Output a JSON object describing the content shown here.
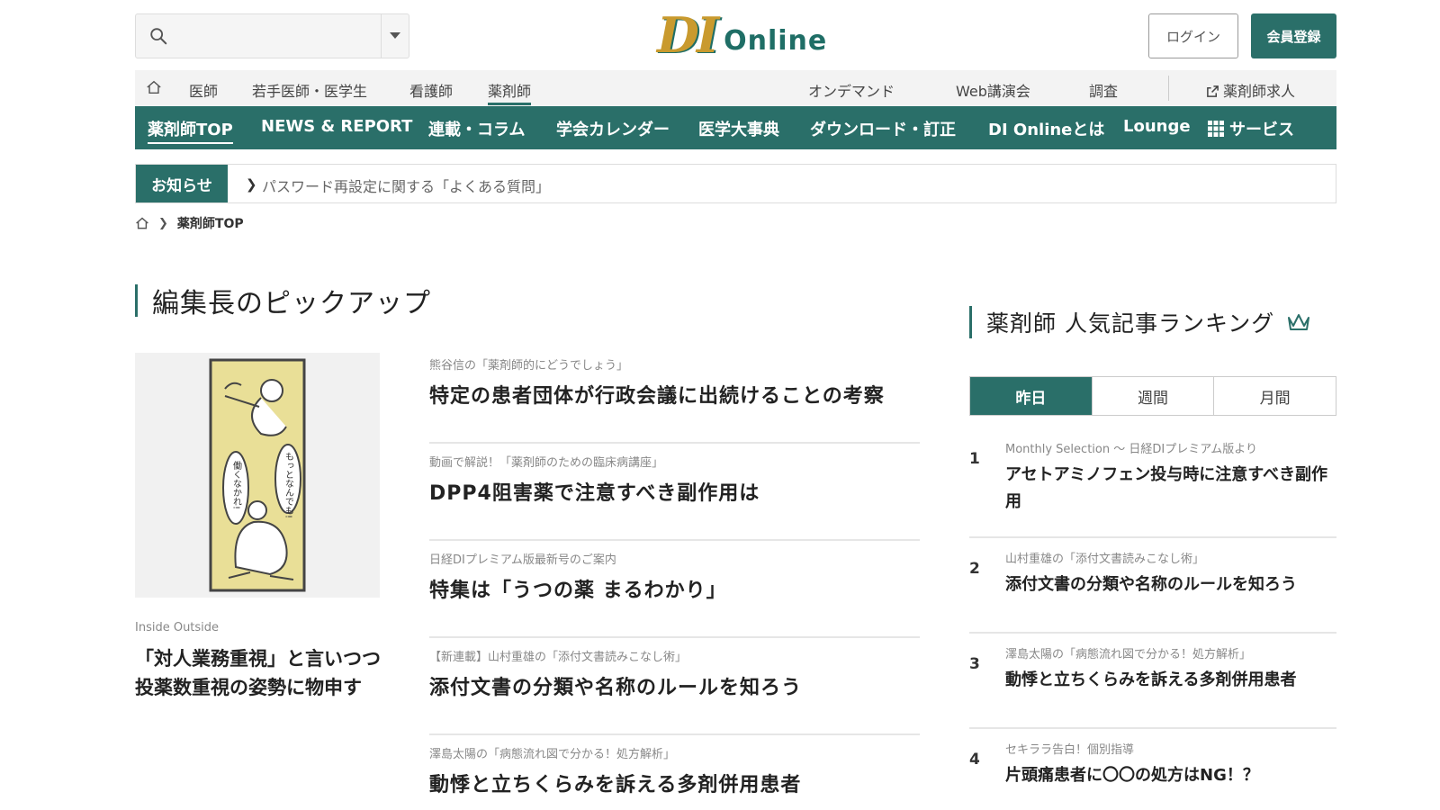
{
  "header": {
    "search_placeholder": "",
    "logo_di": "DI",
    "logo_online": "Online",
    "login_label": "ログイン",
    "register_label": "会員登録"
  },
  "top_nav": {
    "items": [
      "医師",
      "若手医師・医学生",
      "看護師",
      "薬剤師",
      "オンデマンド",
      "Web講演会",
      "調査",
      "薬剤師求人"
    ],
    "active": "薬剤師"
  },
  "main_nav": {
    "items": [
      "薬剤師TOP",
      "NEWS & REPORT",
      "連載・コラム",
      "学会カレンダー",
      "医学大事典",
      "ダウンロード・訂正",
      "DI Onlineとは",
      "Lounge",
      "サービス"
    ],
    "active": "薬剤師TOP"
  },
  "notice": {
    "label": "お知らせ",
    "text": "パスワード再設定に関する「よくある質問」"
  },
  "breadcrumb": {
    "current": "薬剤師TOP"
  },
  "pickup": {
    "heading": "編集長のピックアップ",
    "feature": {
      "category": "Inside Outside",
      "title": "「対人業務重視」と言いつつ投薬数重視の姿勢に物申す",
      "illustration_text_left": "働くなかれ!",
      "illustration_text_right": "もっとなんでも!"
    },
    "articles": [
      {
        "sub": "熊谷信の「薬剤師的にどうでしょう」",
        "title": "特定の患者団体が行政会議に出続けることの考察"
      },
      {
        "sub": "動画で解説！「薬剤師のための臨床病講座」",
        "title": "DPP4阻害薬で注意すべき副作用は"
      },
      {
        "sub": "日経DIプレミアム版最新号のご案内",
        "title": "特集は「うつの薬 まるわかり」"
      },
      {
        "sub": "【新連載】山村重雄の「添付文書読みこなし術」",
        "title": "添付文書の分類や名称のルールを知ろう"
      },
      {
        "sub": "澤島太陽の「病態流れ図で分かる！処方解析」",
        "title": "動悸と立ちくらみを訴える多剤併用患者"
      }
    ]
  },
  "ranking": {
    "heading": "薬剤師 人気記事ランキング",
    "tabs": [
      "昨日",
      "週間",
      "月間"
    ],
    "active_tab": "昨日",
    "items": [
      {
        "num": "1",
        "sub": "Monthly Selection ～ 日経DIプレミアム版より",
        "title": "アセトアミノフェン投与時に注意すべき副作用"
      },
      {
        "num": "2",
        "sub": "山村重雄の「添付文書読みこなし術」",
        "title": "添付文書の分類や名称のルールを知ろう"
      },
      {
        "num": "3",
        "sub": "澤島太陽の「病態流れ図で分かる！処方解析」",
        "title": "動悸と立ちくらみを訴える多剤併用患者"
      },
      {
        "num": "4",
        "sub": "セキララ告白！個別指導",
        "title": "片頭痛患者に〇〇の処方はNG！？"
      }
    ]
  },
  "colors": {
    "brand_green": "#2a6f69",
    "logo_gold": "#c99a2e"
  }
}
